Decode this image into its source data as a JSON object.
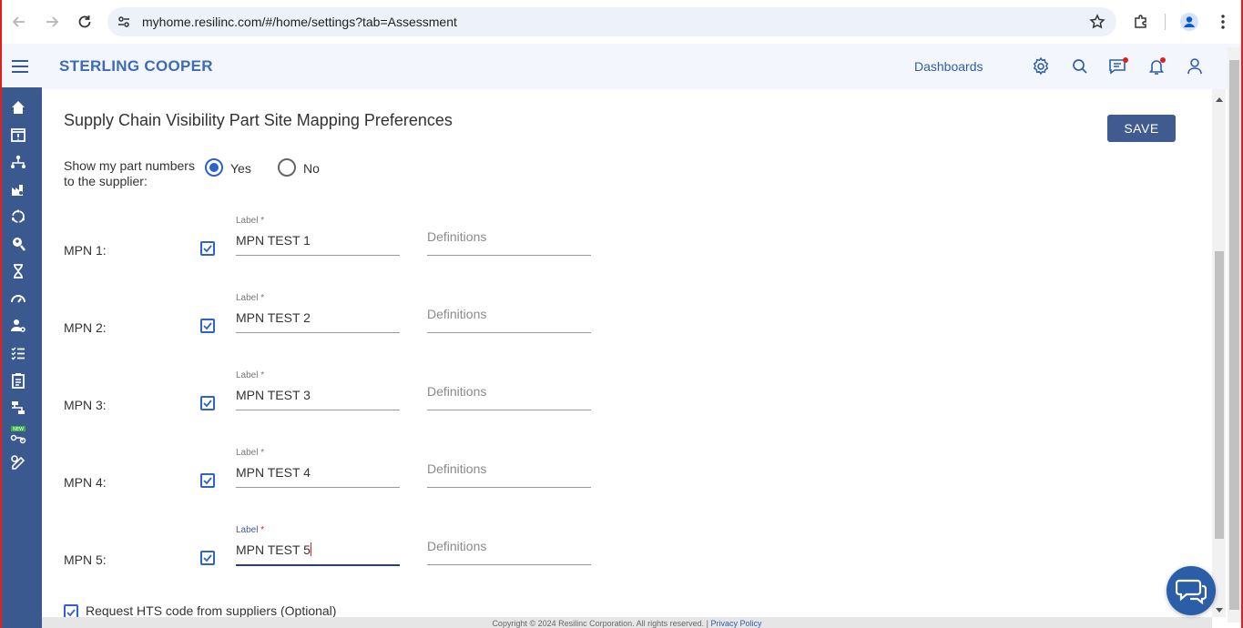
{
  "browser": {
    "url": "myhome.resilinc.com/#/home/settings?tab=Assessment"
  },
  "header": {
    "brand": "STERLING COOPER",
    "dashboards_label": "Dashboards"
  },
  "sidebar": {
    "items": [
      "home-icon",
      "calendar-alert-icon",
      "network-icon",
      "factory-icon",
      "cycle-icon",
      "search-person-icon",
      "hourglass-icon",
      "speedometer-icon",
      "user-settings-icon",
      "checklist-icon",
      "clipboard-icon",
      "flow-icon",
      "new-feature-icon",
      "edit-tool-icon"
    ]
  },
  "main": {
    "title": "Supply Chain Visibility Part Site Mapping Preferences",
    "save_label": "SAVE",
    "show_part_label": "Show my part numbers to the supplier:",
    "radio_yes": "Yes",
    "radio_no": "No",
    "selected": "Yes",
    "mpn_rows": [
      {
        "name": "MPN 1:",
        "label": "Label",
        "required": "*",
        "value": "MPN TEST 1",
        "definitions": "Definitions",
        "checked": true
      },
      {
        "name": "MPN 2:",
        "label": "Label",
        "required": "*",
        "value": "MPN TEST 2",
        "definitions": "Definitions",
        "checked": true
      },
      {
        "name": "MPN 3:",
        "label": "Label",
        "required": "*",
        "value": "MPN TEST 3",
        "definitions": "Definitions",
        "checked": true
      },
      {
        "name": "MPN 4:",
        "label": "Label",
        "required": "*",
        "value": "MPN TEST 4",
        "definitions": "Definitions",
        "checked": true
      },
      {
        "name": "MPN 5:",
        "label": "Label",
        "required": "*",
        "value": "MPN TEST 5",
        "definitions": "Definitions",
        "checked": true
      }
    ],
    "hts_label": "Request HTS code from suppliers (Optional)"
  },
  "footer": {
    "copyright": "Copyright © 2024 Resilinc Corporation. All rights reserved. |",
    "privacy": "Privacy Policy"
  },
  "colors": {
    "accent": "#2f63c9",
    "sidebar": "#3a5a8f",
    "save_button": "#3f5b8f",
    "brand": "#3f6bb5"
  }
}
